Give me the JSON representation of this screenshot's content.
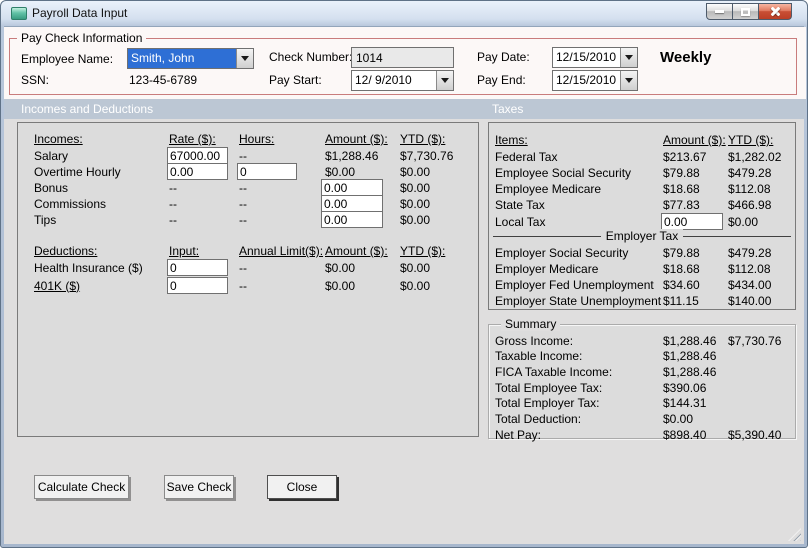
{
  "window": {
    "title": "Payroll Data Input"
  },
  "colors": {
    "section_band": "#bcc7d4",
    "group_border_red": "#c97c7c",
    "selection_blue": "#2e6fd5",
    "close_button_red": "#c94f35",
    "panel_bg": "#dcdcdc"
  },
  "paycheck": {
    "group_label": "Pay Check Information",
    "employee_name": {
      "label": "Employee Name:",
      "value": "Smith, John"
    },
    "ssn": {
      "label": "SSN:",
      "value": "123-45-6789"
    },
    "check_number": {
      "label": "Check Number:",
      "value": "1014"
    },
    "pay_start": {
      "label": "Pay Start:",
      "value": "12/ 9/2010"
    },
    "pay_date": {
      "label": "Pay Date:",
      "value": "12/15/2010"
    },
    "pay_end": {
      "label": "Pay End:",
      "value": "12/15/2010"
    },
    "frequency": "Weekly"
  },
  "sections": {
    "left": "Incomes and Deductions",
    "right": "Taxes"
  },
  "incomes": {
    "headers": {
      "c0": "Incomes:",
      "c1": "Rate ($):",
      "c2": "Hours:",
      "c3": "Amount ($):",
      "c4": "YTD ($):"
    },
    "salary": {
      "label": "Salary",
      "rate": "67000.00",
      "hours": "--",
      "amount": "$1,288.46",
      "ytd": "$7,730.76"
    },
    "overtime": {
      "label": "Overtime Hourly",
      "rate": "0.00",
      "hours": "0",
      "amount": "$0.00",
      "ytd": "$0.00"
    },
    "bonus": {
      "label": "Bonus",
      "rate": "--",
      "hours": "--",
      "amount": "0.00",
      "ytd": "$0.00"
    },
    "commissions": {
      "label": "Commissions",
      "rate": "--",
      "hours": "--",
      "amount": "0.00",
      "ytd": "$0.00"
    },
    "tips": {
      "label": "Tips",
      "rate": "--",
      "hours": "--",
      "amount": "0.00",
      "ytd": "$0.00"
    }
  },
  "deductions": {
    "headers": {
      "c0": "Deductions:",
      "c1": "Input:",
      "c2": "Annual Limit($):",
      "c3": "Amount ($):",
      "c4": "YTD ($):"
    },
    "health": {
      "label": "Health Insurance ($)",
      "input": "0",
      "limit": "--",
      "amount": "$0.00",
      "ytd": "$0.00"
    },
    "k401": {
      "label": "401K ($)",
      "input": "0",
      "limit": "--",
      "amount": "$0.00",
      "ytd": "$0.00"
    }
  },
  "taxes": {
    "headers": {
      "c0": "Items:",
      "c1": "Amount ($):",
      "c2": "YTD ($):"
    },
    "federal": {
      "label": "Federal Tax",
      "amount": "$213.67",
      "ytd": "$1,282.02"
    },
    "emp_ss": {
      "label": "Employee Social Security",
      "amount": "$79.88",
      "ytd": "$479.28"
    },
    "emp_medicare": {
      "label": "Employee Medicare",
      "amount": "$18.68",
      "ytd": "$112.08"
    },
    "state": {
      "label": "State Tax",
      "amount": "$77.83",
      "ytd": "$466.98"
    },
    "local": {
      "label": "Local Tax",
      "amount": "0.00",
      "ytd": "$0.00"
    },
    "employer_group_label": "Employer Tax",
    "er_ss": {
      "label": "Employer Social Security",
      "amount": "$79.88",
      "ytd": "$479.28"
    },
    "er_medicare": {
      "label": "Employer Medicare",
      "amount": "$18.68",
      "ytd": "$112.08"
    },
    "er_fed_unemp": {
      "label": "Employer Fed Unemployment",
      "amount": "$34.60",
      "ytd": "$434.00"
    },
    "er_state_unemp": {
      "label": "Employer State Unemployment",
      "amount": "$11.15",
      "ytd": "$140.00"
    }
  },
  "summary": {
    "group_label": "Summary",
    "gross": {
      "label": "Gross Income:",
      "amount": "$1,288.46",
      "ytd": "$7,730.76"
    },
    "taxable": {
      "label": "Taxable Income:",
      "amount": "$1,288.46",
      "ytd": ""
    },
    "fica": {
      "label": "FICA Taxable Income:",
      "amount": "$1,288.46",
      "ytd": ""
    },
    "total_employee_tax": {
      "label": "Total Employee Tax:",
      "amount": "$390.06",
      "ytd": ""
    },
    "total_employer_tax": {
      "label": "Total Employer Tax:",
      "amount": "$144.31",
      "ytd": ""
    },
    "total_deduction": {
      "label": "Total Deduction:",
      "amount": "$0.00",
      "ytd": ""
    },
    "net_pay": {
      "label": "Net Pay:",
      "amount": "$898.40",
      "ytd": "$5,390.40"
    }
  },
  "buttons": {
    "calculate": "Calculate Check",
    "save": "Save Check",
    "close": "Close"
  }
}
